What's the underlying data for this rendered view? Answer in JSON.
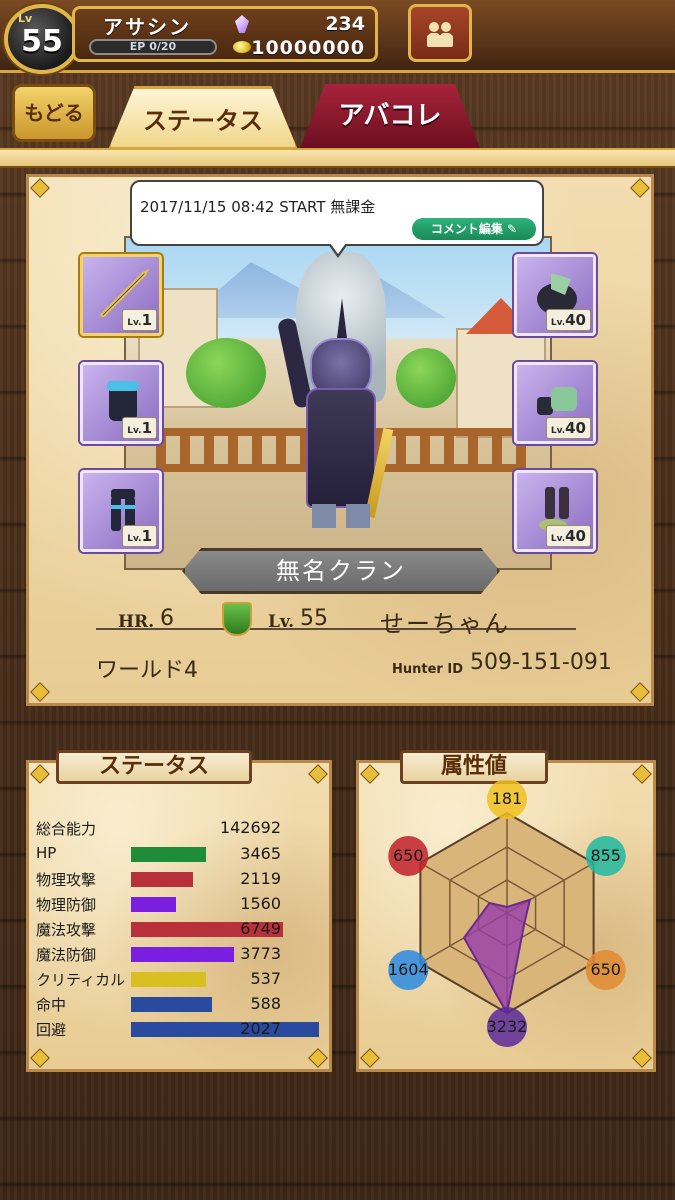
{
  "header": {
    "level_label": "Lv",
    "level": "55",
    "player_name": "アサシン",
    "ep": "EP 0/20",
    "crystals": "234",
    "zenny": "10000000"
  },
  "nav": {
    "back_label": "もどる",
    "tab_status": "ステータス",
    "tab_avacole": "アバコレ"
  },
  "profile": {
    "comment": "2017/11/15 08:42 START 無課金",
    "edit_comment_label": "コメント編集",
    "clan_name": "無名クラン",
    "hr_label": "HR.",
    "hr": "6",
    "lv_label": "Lv.",
    "lv": "55",
    "hunter_name": "せーちゃん",
    "world": "ワールド4",
    "hunter_id_label": "Hunter ID",
    "hunter_id": "509-151-091",
    "equipment_left": [
      {
        "name": "weapon",
        "level_prefix": "Lv.",
        "level": "1"
      },
      {
        "name": "chest",
        "level_prefix": "Lv.",
        "level": "1"
      },
      {
        "name": "legs",
        "level_prefix": "Lv.",
        "level": "1"
      }
    ],
    "equipment_right": [
      {
        "name": "helm",
        "level_prefix": "Lv.",
        "level": "40"
      },
      {
        "name": "arms",
        "level_prefix": "Lv.",
        "level": "40"
      },
      {
        "name": "boots",
        "level_prefix": "Lv.",
        "level": "40"
      }
    ]
  },
  "status": {
    "title": "ステータス",
    "total_label": "総合能力",
    "total": "142692",
    "rows": [
      {
        "label": "HP",
        "value": "3465",
        "color": "#1f8c3a",
        "fill": 0.4
      },
      {
        "label": "物理攻撃",
        "value": "2119",
        "color": "#b8303a",
        "fill": 0.33
      },
      {
        "label": "物理防御",
        "value": "1560",
        "color": "#7a1ee0",
        "fill": 0.24
      },
      {
        "label": "魔法攻撃",
        "value": "6749",
        "color": "#b8303a",
        "fill": 0.81
      },
      {
        "label": "魔法防御",
        "value": "3773",
        "color": "#7a1ee0",
        "fill": 0.55
      },
      {
        "label": "クリティカル",
        "value": "537",
        "color": "#d8c020",
        "fill": 0.4
      },
      {
        "label": "命中",
        "value": "588",
        "color": "#2a4aa0",
        "fill": 0.43
      },
      {
        "label": "回避",
        "value": "2027",
        "color": "#2a4aa0",
        "fill": 1.0
      }
    ]
  },
  "attributes": {
    "title": "属性値",
    "values": [
      {
        "name": "light",
        "value": "181",
        "color": "#f0c020"
      },
      {
        "name": "wind",
        "value": "855",
        "color": "#20b8a0"
      },
      {
        "name": "earth",
        "value": "650",
        "color": "#e08a30"
      },
      {
        "name": "dark",
        "value": "3232",
        "color": "#5a2a9a"
      },
      {
        "name": "water",
        "value": "1604",
        "color": "#2a8ae0"
      },
      {
        "name": "fire",
        "value": "650",
        "color": "#c0202a"
      }
    ],
    "max": 3232
  }
}
